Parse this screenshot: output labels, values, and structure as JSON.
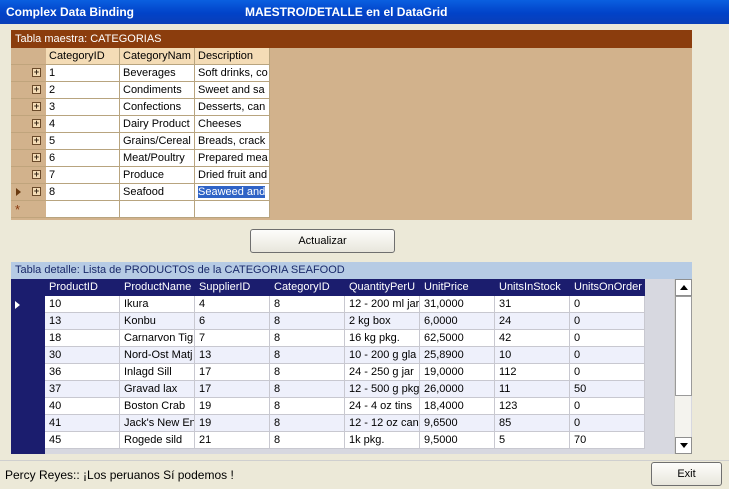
{
  "window": {
    "title": "Complex Data Binding",
    "subtitle": "MAESTRO/DETALLE  en el DataGrid"
  },
  "master": {
    "caption": "Tabla maestra: CATEGORIAS",
    "columns": [
      "CategoryID",
      "CategoryNam",
      "Description"
    ],
    "rows": [
      [
        "1",
        "Beverages",
        "Soft drinks, co"
      ],
      [
        "2",
        "Condiments",
        "Sweet and sa"
      ],
      [
        "3",
        "Confections",
        "Desserts, can"
      ],
      [
        "4",
        "Dairy Product",
        "Cheeses"
      ],
      [
        "5",
        "Grains/Cereal",
        "Breads, crack"
      ],
      [
        "6",
        "Meat/Poultry",
        "Prepared mea"
      ],
      [
        "7",
        "Produce",
        "Dried fruit and"
      ],
      [
        "8",
        "Seafood",
        "Seaweed and"
      ]
    ],
    "expand_glyph": "+",
    "new_row_glyph": "*"
  },
  "actions": {
    "refresh_label": "Actualizar",
    "exit_label": "Exit"
  },
  "detail": {
    "caption": "Tabla detalle: Lista de PRODUCTOS de la CATEGORIA SEAFOOD",
    "columns": [
      "ProductID",
      "ProductName",
      "SupplierID",
      "CategoryID",
      "QuantityPerU",
      "UnitPrice",
      "UnitsInStock",
      "UnitsOnOrder"
    ],
    "rows": [
      [
        "10",
        "Ikura",
        "4",
        "8",
        "12 - 200 ml jar",
        "31,0000",
        "31",
        "0"
      ],
      [
        "13",
        "Konbu",
        "6",
        "8",
        "2 kg box",
        "6,0000",
        "24",
        "0"
      ],
      [
        "18",
        "Carnarvon Tig",
        "7",
        "8",
        "16 kg pkg.",
        "62,5000",
        "42",
        "0"
      ],
      [
        "30",
        "Nord-Ost Matj",
        "13",
        "8",
        "10 - 200 g gla",
        "25,8900",
        "10",
        "0"
      ],
      [
        "36",
        "Inlagd Sill",
        "17",
        "8",
        "24 - 250 g  jar",
        "19,0000",
        "112",
        "0"
      ],
      [
        "37",
        "Gravad lax",
        "17",
        "8",
        "12 - 500 g pkg",
        "26,0000",
        "11",
        "50"
      ],
      [
        "40",
        "Boston Crab",
        "19",
        "8",
        "24 - 4 oz tins",
        "18,4000",
        "123",
        "0"
      ],
      [
        "41",
        "Jack's New En",
        "19",
        "8",
        "12 - 12 oz can",
        "9,6500",
        "85",
        "0"
      ],
      [
        "45",
        "Rogede sild",
        "21",
        "8",
        "1k pkg.",
        "9,5000",
        "5",
        "70"
      ]
    ]
  },
  "status": {
    "text": "Percy Reyes:: ¡Los peruanos Sí podemos !"
  },
  "colors": {
    "master_caption": "#8b3d0d",
    "master_bg": "#d2b28c",
    "detail_header": "#1b1d6e",
    "selection": "#2f63c6"
  }
}
